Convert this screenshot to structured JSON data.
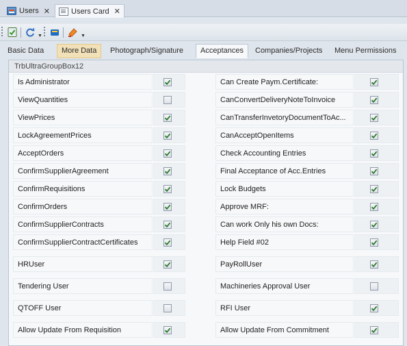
{
  "document_tabs": [
    {
      "label": "Users",
      "icon": "users-grid-icon",
      "active": false
    },
    {
      "label": "Users Card",
      "icon": "card-icon",
      "active": true
    }
  ],
  "toolbar": {
    "buttons": [
      "save-icon",
      "refresh-icon",
      "edit-icon",
      "delete-icon"
    ]
  },
  "page_tabs": [
    {
      "label": "Basic Data",
      "state": "normal"
    },
    {
      "label": "More Data",
      "state": "hover"
    },
    {
      "label": "Photograph/Signature",
      "state": "normal"
    },
    {
      "label": "Acceptances",
      "state": "active"
    },
    {
      "label": "Companies/Projects",
      "state": "normal"
    },
    {
      "label": "Menu Permissions",
      "state": "normal"
    }
  ],
  "group_title": "TrbUltraGroupBox12",
  "left_permissions": [
    {
      "label": "Is Administrator",
      "checked": true
    },
    {
      "label": "ViewQuantities",
      "checked": false
    },
    {
      "label": "ViewPrices",
      "checked": true
    },
    {
      "label": "LockAgreementPrices",
      "checked": true
    },
    {
      "label": "AcceptOrders",
      "checked": true
    },
    {
      "label": "ConfirmSupplierAgreement",
      "checked": true
    },
    {
      "label": "ConfirmRequisitions",
      "checked": true
    },
    {
      "label": "ConfirmOrders",
      "checked": true
    },
    {
      "label": "ConfirmSupplierContracts",
      "checked": true
    },
    {
      "label": "ConfirmSupplierContractCertificates",
      "checked": true
    },
    {
      "label": "HRUser",
      "checked": true
    },
    {
      "label": "Tendering User",
      "checked": false
    },
    {
      "label": "QTOFF User",
      "checked": false
    },
    {
      "label": "Allow Update From Requisition",
      "checked": true
    }
  ],
  "right_permissions": [
    {
      "label": "Can Create Paym.Certificate:",
      "checked": true
    },
    {
      "label": "CanConvertDeliveryNoteToInvoice",
      "checked": true
    },
    {
      "label": "CanTransferInvetoryDocumentToAc...",
      "checked": true
    },
    {
      "label": "CanAcceptOpenItems",
      "checked": true
    },
    {
      "label": "Check Accounting Entries",
      "checked": true
    },
    {
      "label": "Final Acceptance of Acc.Entries",
      "checked": true
    },
    {
      "label": "Lock Budgets",
      "checked": true
    },
    {
      "label": "Approve MRF:",
      "checked": true
    },
    {
      "label": "Can work Only his own Docs:",
      "checked": true
    },
    {
      "label": "Help Field #02",
      "checked": true
    },
    {
      "label": "PayRollUser",
      "checked": true
    },
    {
      "label": "Machineries Approval User",
      "checked": false
    },
    {
      "label": "RFI User",
      "checked": true
    },
    {
      "label": "Allow Update From Commitment",
      "checked": true
    }
  ],
  "colors": {
    "accent": "#2e6fc0",
    "check": "#2a7a2a",
    "hover_tab": "#f1e0b8"
  }
}
